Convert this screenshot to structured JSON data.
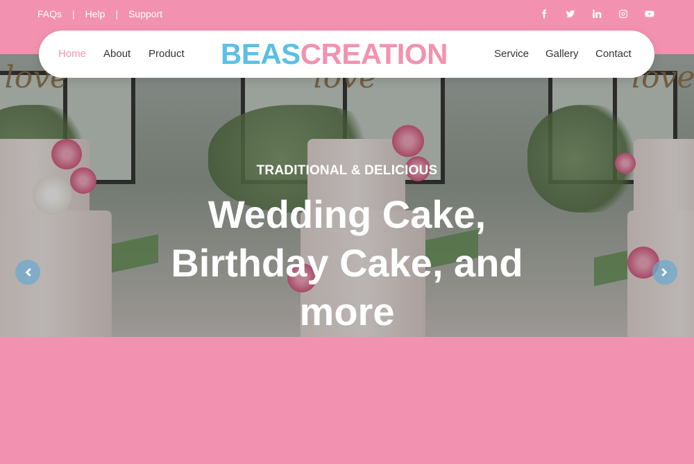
{
  "topbar": {
    "links": [
      "FAQs",
      "Help",
      "Support"
    ],
    "separator": "|",
    "social": [
      "facebook-icon",
      "twitter-icon",
      "linkedin-icon",
      "instagram-icon",
      "youtube-icon"
    ]
  },
  "nav": {
    "left": [
      "Home",
      "About",
      "Product"
    ],
    "right": [
      "Service",
      "Gallery",
      "Contact"
    ],
    "active": "Home"
  },
  "brand": {
    "part1": "BEAS",
    "part2": "CREATION"
  },
  "hero": {
    "subtitle": "TRADITIONAL & DELICIOUS",
    "title": "Wedding Cake, Birthday Cake, and more",
    "prev_icon": "chevron-left-icon",
    "next_icon": "chevron-right-icon"
  },
  "colors": {
    "pink": "#f392b0",
    "blue": "#5bbfe6",
    "white": "#ffffff",
    "text": "#333333"
  }
}
